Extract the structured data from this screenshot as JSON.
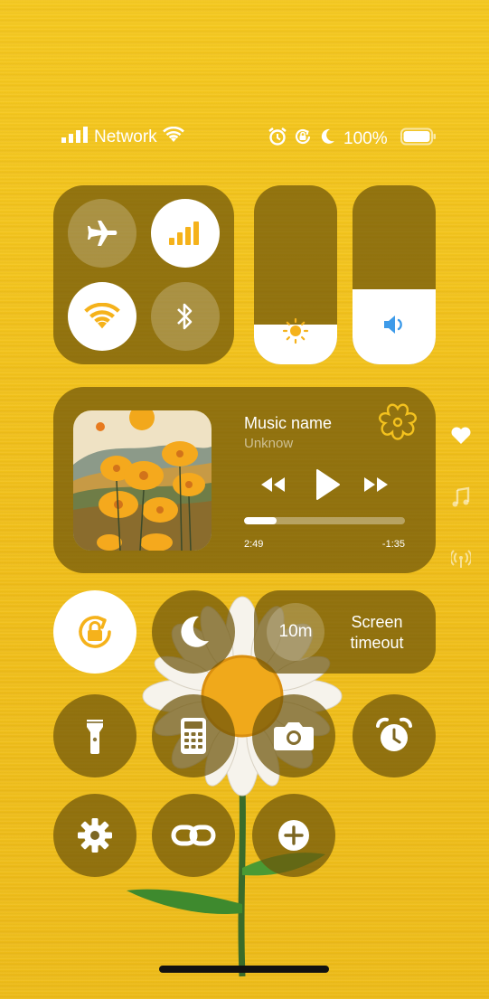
{
  "status_bar": {
    "carrier": "Network",
    "battery_text": "100%",
    "battery_level": 1.0
  },
  "sliders": {
    "brightness_level": 0.22,
    "volume_level": 0.42
  },
  "media": {
    "title": "Music name",
    "artist": "Unknow",
    "elapsed": "2:49",
    "remaining": "-1:35",
    "progress": 0.2
  },
  "screen_timeout": {
    "value": "10m",
    "label_line1": "Screen",
    "label_line2": "timeout"
  },
  "colors": {
    "accent": "#f5b21b",
    "panel": "#6e550a",
    "volume_icon": "#3e9be9",
    "background": "#f2c21e"
  }
}
